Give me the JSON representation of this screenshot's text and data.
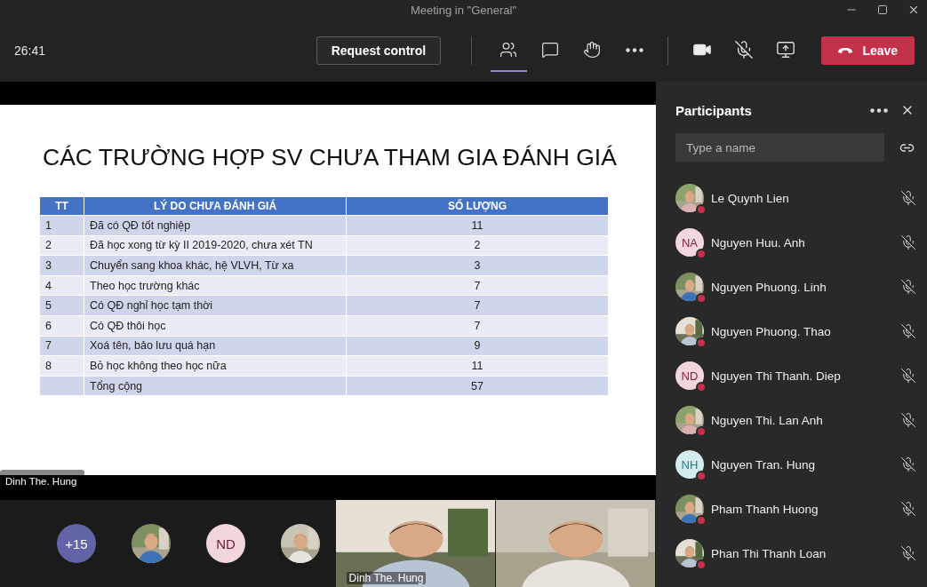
{
  "window": {
    "title": "Meeting in \"General\""
  },
  "toolbar": {
    "timer": "26:41",
    "request_control": "Request control",
    "tools": [
      {
        "kind": "people",
        "selected": true
      },
      {
        "kind": "chat",
        "selected": false
      },
      {
        "kind": "reactions",
        "selected": false
      },
      {
        "kind": "more",
        "selected": false
      }
    ],
    "devices": [
      {
        "kind": "camera"
      },
      {
        "kind": "mic-off"
      },
      {
        "kind": "share"
      }
    ],
    "leave": "Leave"
  },
  "slide": {
    "title": "CÁC TRƯỜNG HỢP SV CHƯA THAM GIA ĐÁNH GIÁ",
    "columns": [
      "TT",
      "LÝ DO CHƯA ĐÁNH GIÁ",
      "SỐ LƯỢNG"
    ],
    "rows": [
      [
        "1",
        "Đã có QĐ tốt nghiệp",
        "11"
      ],
      [
        "2",
        "Đã học xong từ kỳ II 2019-2020, chưa xét TN",
        "2"
      ],
      [
        "3",
        "Chuyển sang khoa khác, hệ VLVH, Từ xa",
        "3"
      ],
      [
        "4",
        "Theo học trường khác",
        "7"
      ],
      [
        "5",
        "Có QĐ nghỉ học tạm thời",
        "7"
      ],
      [
        "6",
        "Có QĐ thôi học",
        "7"
      ],
      [
        "7",
        "Xoá tên, bảo lưu quá hạn",
        "9"
      ],
      [
        "8",
        "Bỏ học không theo học nữa",
        "11"
      ],
      [
        "",
        "Tổng cộng",
        "57"
      ]
    ]
  },
  "presenter_label": "Dinh The. Hung",
  "gallery": [
    {
      "kind": "count",
      "text": "+15",
      "color": "#6264a7"
    },
    {
      "kind": "picture"
    },
    {
      "kind": "initials",
      "text": "ND",
      "color": "#f2d6dc"
    },
    {
      "kind": "picture"
    }
  ],
  "videos": [
    {
      "kind": "picture",
      "name": "Dinh The. Hung"
    },
    {
      "kind": "picture"
    }
  ],
  "participants": {
    "title": "Participants",
    "search": {
      "placeholder": "Type a name"
    },
    "people": [
      {
        "name": "Le Quynh Lien",
        "avatar": {
          "kind": "picture"
        }
      },
      {
        "name": "Nguyen Huu. Anh",
        "avatar": {
          "kind": "initials",
          "text": "NA",
          "color": "#f4d6de"
        }
      },
      {
        "name": "Nguyen Phuong. Linh",
        "avatar": {
          "kind": "picture"
        }
      },
      {
        "name": "Nguyen Phuong. Thao",
        "avatar": {
          "kind": "picture"
        }
      },
      {
        "name": "Nguyen Thi Thanh. Diep",
        "avatar": {
          "kind": "initials",
          "text": "ND",
          "color": "#f2d6dc"
        }
      },
      {
        "name": "Nguyen Thi. Lan Anh",
        "avatar": {
          "kind": "picture"
        }
      },
      {
        "name": "Nguyen Tran. Hung",
        "avatar": {
          "kind": "initials",
          "text": "NH",
          "color": "#d3edef"
        }
      },
      {
        "name": "Pham Thanh Huong",
        "avatar": {
          "kind": "picture"
        }
      },
      {
        "name": "Phan Thi Thanh Loan",
        "avatar": {
          "kind": "picture"
        }
      }
    ]
  }
}
